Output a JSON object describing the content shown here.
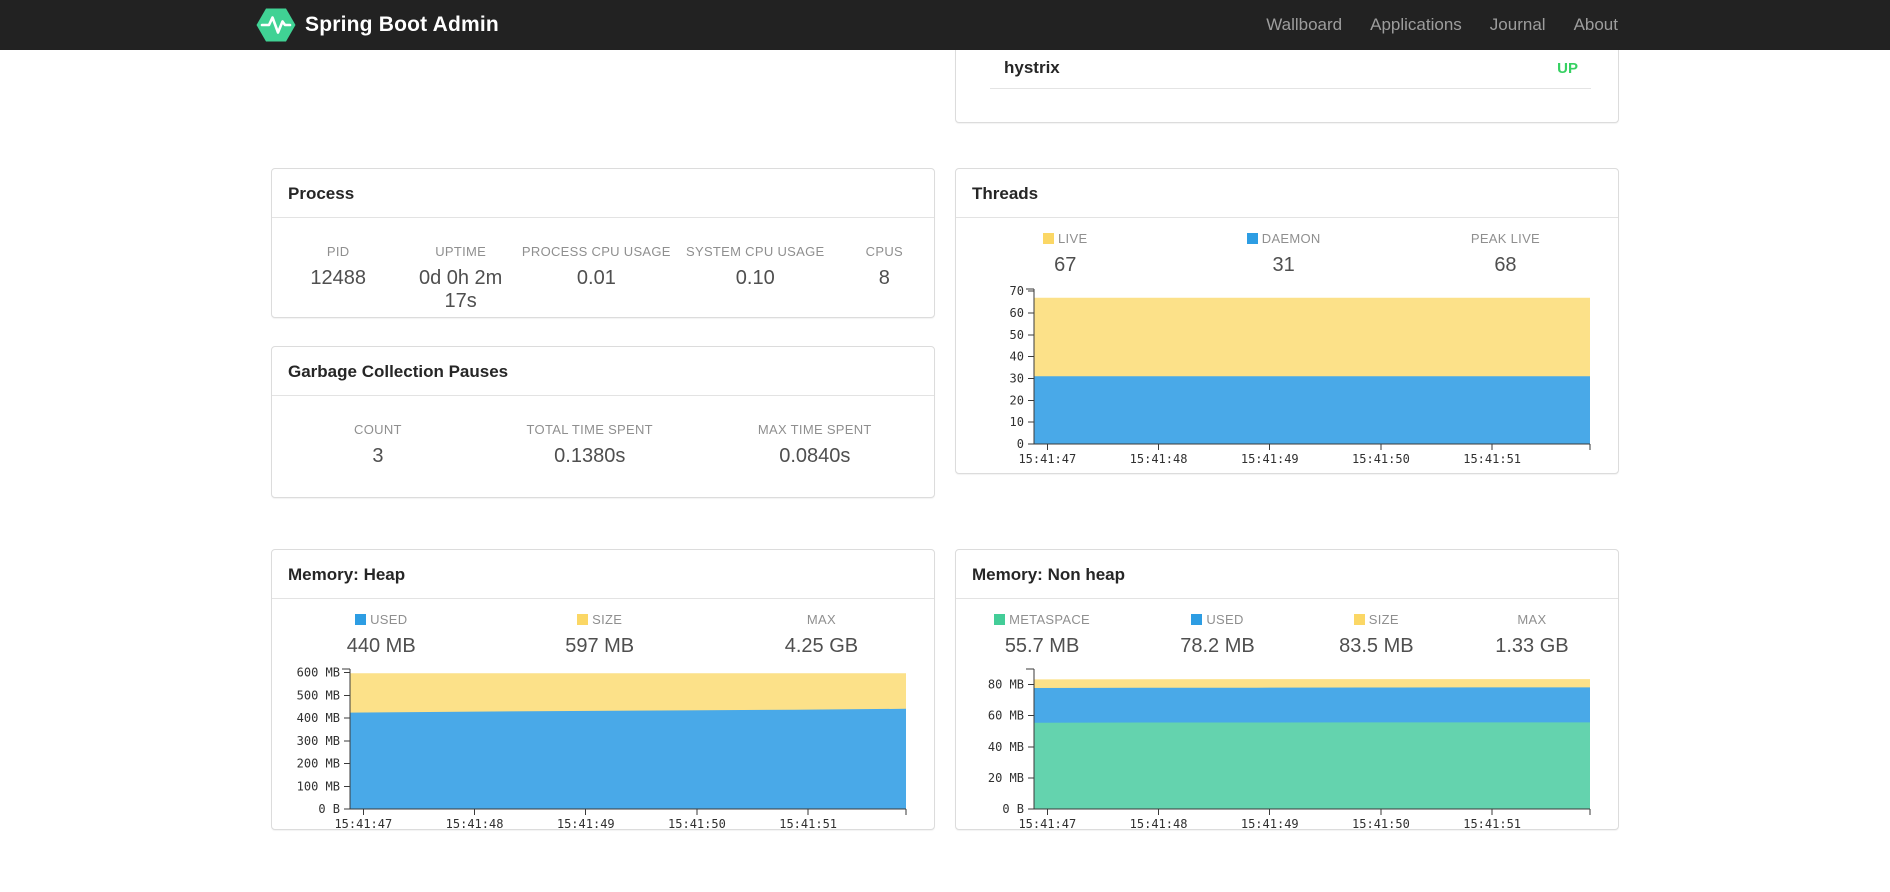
{
  "navbar": {
    "brand": "Spring Boot Admin",
    "links": [
      "Wallboard",
      "Applications",
      "Journal",
      "About"
    ]
  },
  "application_status": {
    "name": "hystrix",
    "status": "UP",
    "status_color": "#36d162"
  },
  "colors": {
    "navbar_bg": "#222222",
    "nav_link": "#9d9d9d",
    "legend_yellow": "#fbd765",
    "legend_blue": "#2d9de3",
    "legend_green": "#43cd98",
    "area_yellow": "#fce189",
    "area_blue": "#49a9e8",
    "area_green": "#64d3ae"
  },
  "panels": {
    "process": {
      "title": "Process",
      "stats": [
        {
          "label": "PID",
          "value": "12488"
        },
        {
          "label": "UPTIME",
          "value": "0d 0h 2m 17s"
        },
        {
          "label": "PROCESS CPU USAGE",
          "value": "0.01"
        },
        {
          "label": "SYSTEM CPU USAGE",
          "value": "0.10"
        },
        {
          "label": "CPUS",
          "value": "8"
        }
      ]
    },
    "gc": {
      "title": "Garbage Collection Pauses",
      "stats": [
        {
          "label": "COUNT",
          "value": "3"
        },
        {
          "label": "TOTAL TIME SPENT",
          "value": "0.1380s"
        },
        {
          "label": "MAX TIME SPENT",
          "value": "0.0840s"
        }
      ]
    },
    "threads": {
      "title": "Threads",
      "stats": [
        {
          "label": "LIVE",
          "value": "67",
          "swatch": "#fbd765"
        },
        {
          "label": "DAEMON",
          "value": "31",
          "swatch": "#2d9de3"
        },
        {
          "label": "PEAK LIVE",
          "value": "68"
        }
      ]
    },
    "heap": {
      "title": "Memory: Heap",
      "stats": [
        {
          "label": "USED",
          "value": "440 MB",
          "swatch": "#2d9de3"
        },
        {
          "label": "SIZE",
          "value": "597 MB",
          "swatch": "#fbd765"
        },
        {
          "label": "MAX",
          "value": "4.25 GB"
        }
      ]
    },
    "nonheap": {
      "title": "Memory: Non heap",
      "stats": [
        {
          "label": "METASPACE",
          "value": "55.7 MB",
          "swatch": "#43cd98"
        },
        {
          "label": "USED",
          "value": "78.2 MB",
          "swatch": "#2d9de3"
        },
        {
          "label": "SIZE",
          "value": "83.5 MB",
          "swatch": "#fbd765"
        },
        {
          "label": "MAX",
          "value": "1.33 GB"
        }
      ]
    }
  },
  "chart_data": [
    {
      "id": "threads",
      "type": "area",
      "title": "Threads",
      "x_tick_labels": [
        "15:41:47",
        "15:41:48",
        "15:41:49",
        "15:41:50",
        "15:41:51"
      ],
      "x_start_frac": 0.024,
      "x_tick_gap_frac": 0.2,
      "ylim": [
        0,
        71
      ],
      "y_tick_values": [
        0,
        10,
        20,
        30,
        40,
        50,
        60,
        70
      ],
      "y_tick_labels": [
        "0",
        "10",
        "20",
        "30",
        "40",
        "50",
        "60",
        "70"
      ],
      "grid": false,
      "legend_position": "top",
      "series": [
        {
          "name": "LIVE",
          "color": "#fce189",
          "values": [
            67,
            67,
            67,
            67,
            67,
            67
          ]
        },
        {
          "name": "DAEMON",
          "color": "#49a9e8",
          "values": [
            31,
            31,
            31,
            31,
            31,
            31
          ]
        }
      ]
    },
    {
      "id": "heap",
      "type": "area",
      "title": "Memory: Heap",
      "x_tick_labels": [
        "15:41:47",
        "15:41:48",
        "15:41:49",
        "15:41:50",
        "15:41:51"
      ],
      "x_start_frac": 0.024,
      "x_tick_gap_frac": 0.2,
      "ylim": [
        0,
        616
      ],
      "y_tick_values": [
        0,
        100,
        200,
        300,
        400,
        500,
        600
      ],
      "y_tick_labels": [
        "0 B",
        "100 MB",
        "200 MB",
        "300 MB",
        "400 MB",
        "500 MB",
        "600 MB"
      ],
      "grid": false,
      "legend_position": "top",
      "series": [
        {
          "name": "SIZE",
          "color": "#fce189",
          "values": [
            597,
            597,
            597,
            597,
            597,
            597
          ]
        },
        {
          "name": "USED",
          "color": "#49a9e8",
          "values": [
            424,
            428,
            431,
            434,
            437,
            441
          ]
        }
      ]
    },
    {
      "id": "nonheap",
      "type": "area",
      "title": "Memory: Non heap",
      "x_tick_labels": [
        "15:41:47",
        "15:41:48",
        "15:41:49",
        "15:41:50",
        "15:41:51"
      ],
      "x_start_frac": 0.024,
      "x_tick_gap_frac": 0.2,
      "ylim": [
        0,
        90
      ],
      "y_tick_values": [
        0,
        20,
        40,
        60,
        80
      ],
      "y_tick_labels": [
        "0 B",
        "20 MB",
        "40 MB",
        "60 MB",
        "80 MB"
      ],
      "grid": false,
      "legend_position": "top",
      "series": [
        {
          "name": "SIZE",
          "color": "#fce189",
          "values": [
            83.3,
            83.4,
            83.5,
            83.5,
            83.5,
            83.5
          ]
        },
        {
          "name": "USED",
          "color": "#49a9e8",
          "values": [
            77.8,
            78.0,
            78.0,
            78.1,
            78.2,
            78.2
          ]
        },
        {
          "name": "METASPACE",
          "color": "#64d3ae",
          "values": [
            55.5,
            55.6,
            55.6,
            55.7,
            55.7,
            55.7
          ]
        }
      ]
    }
  ]
}
